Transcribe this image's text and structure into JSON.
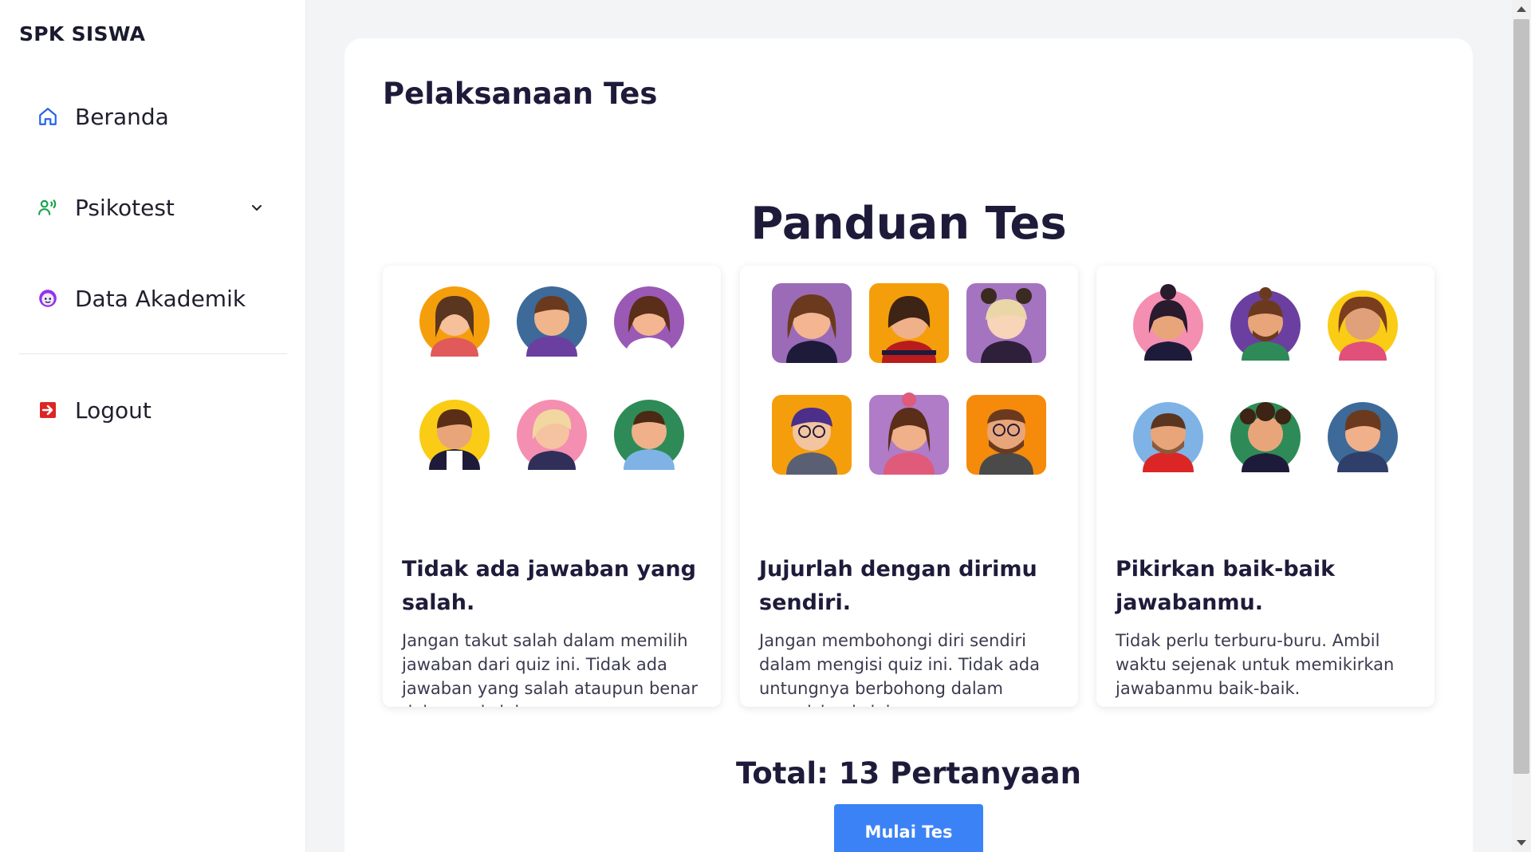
{
  "sidebar": {
    "brand": "SPK SISWA",
    "items": [
      {
        "label": "Beranda",
        "icon": "home-icon"
      },
      {
        "label": "Psikotest",
        "icon": "users-voice-icon"
      },
      {
        "label": "Data Akademik",
        "icon": "face-icon"
      },
      {
        "label": "Logout",
        "icon": "logout-icon"
      }
    ]
  },
  "main": {
    "title": "Pelaksanaan Tes",
    "section_title": "Panduan Tes",
    "cards": [
      {
        "heading": "Tidak ada jawaban yang salah.",
        "text": "Jangan takut salah dalam memilih jawaban dari quiz ini. Tidak ada jawaban yang salah ataupun benar dalam quiz ini."
      },
      {
        "heading": "Jujurlah dengan dirimu sendiri.",
        "text": "Jangan membohongi diri sendiri dalam mengisi quiz ini. Tidak ada untungnya berbohong dalam mengisi quiz ini."
      },
      {
        "heading": "Pikirkan baik-baik jawabanmu.",
        "text": "Tidak perlu terburu-buru. Ambil waktu sejenak untuk memikirkan jawabanmu baik-baik."
      }
    ],
    "total": "Total: 13 Pertanyaan",
    "start_button": "Mulai Tes"
  },
  "colors": {
    "accent": "#3b82f6",
    "text_dark": "#1e1b3a",
    "background": "#f3f4f6"
  }
}
